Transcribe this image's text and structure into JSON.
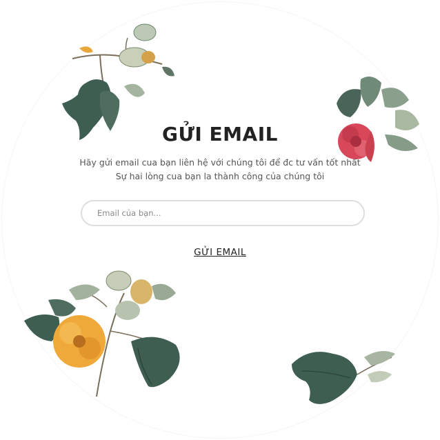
{
  "newsletter": {
    "title": "GỬI EMAIL",
    "description_line1": "Hãy gửi email cua bạn liên hệ với chúng tôi để đc tư vấn tốt nhất",
    "description_line2": "Sự hai lòng cua bạn la thành công của chúng tôi",
    "email_placeholder": "Email của bạn...",
    "email_value": "",
    "submit_label": "GỬI EMAIL"
  },
  "colors": {
    "leaf_dark": "#3f5e52",
    "leaf_light": "#8fa593",
    "flower_red": "#d9485a",
    "flower_orange": "#efa93a",
    "text_dark": "#222222",
    "text_muted": "#555555",
    "input_border": "#dedede"
  }
}
